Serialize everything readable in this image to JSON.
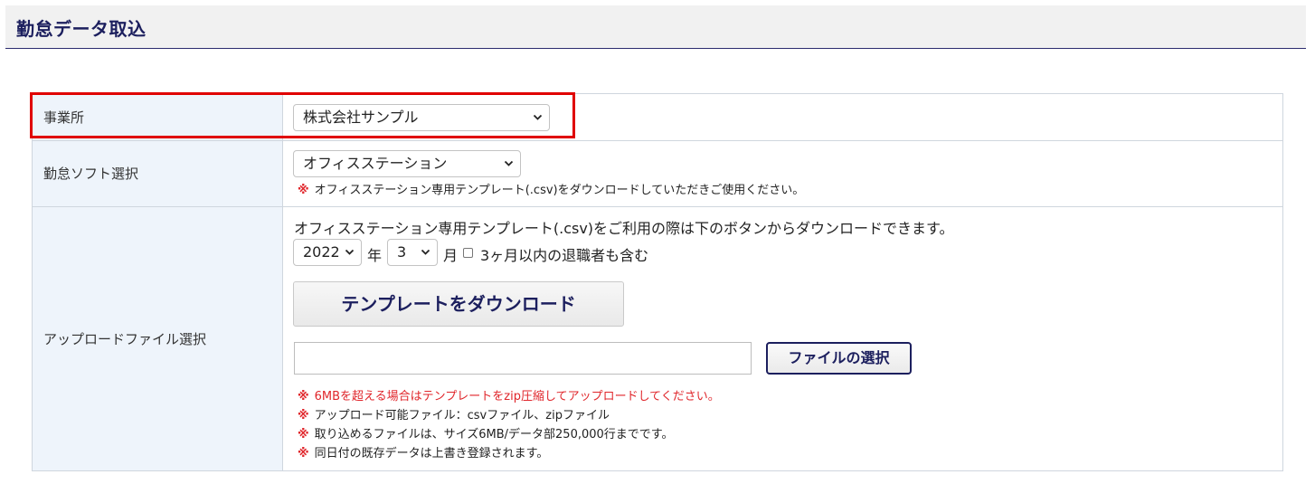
{
  "header": {
    "title": "勤怠データ取込"
  },
  "rows": {
    "office": {
      "label": "事業所",
      "select_value": "株式会社サンプル"
    },
    "software": {
      "label": "勤怠ソフト選択",
      "select_value": "オフィスステーション",
      "note_mark": "※",
      "note": "オフィスステーション専用テンプレート(.csv)をダウンロードしていただきご使用ください。"
    },
    "upload": {
      "label": "アップロードファイル選択",
      "intro": "オフィスステーション専用テンプレート(.csv)をご利用の際は下のボタンからダウンロードできます。",
      "year_value": "2022",
      "year_unit": "年",
      "month_value": "3",
      "month_unit": "月",
      "retired_checkbox_label": "3ヶ月以内の退職者も含む",
      "retired_checked": false,
      "download_button": "テンプレートをダウンロード",
      "file_value": "",
      "file_button": "ファイルの選択",
      "notes": [
        {
          "mark": "※",
          "text": "6MBを超える場合はテンプレートをzip圧縮してアップロードしてください。",
          "color": "#e0262b"
        },
        {
          "mark": "※",
          "text": "アップロード可能ファイル：csvファイル、zipファイル",
          "color": "#222222"
        },
        {
          "mark": "※",
          "text": "取り込めるファイルは、サイズ6MB/データ部250,000行までです。",
          "color": "#222222"
        },
        {
          "mark": "※",
          "text": "同日付の既存データは上書き登録されます。",
          "color": "#222222"
        }
      ]
    }
  },
  "icons": {
    "dropdown": "chevron-down-icon",
    "note_mark": "asterisk-mark"
  },
  "colors": {
    "accent": "#1c1f5e",
    "warning": "#e0262b",
    "highlight": "#e00000",
    "label_bg": "#eef4fb"
  }
}
